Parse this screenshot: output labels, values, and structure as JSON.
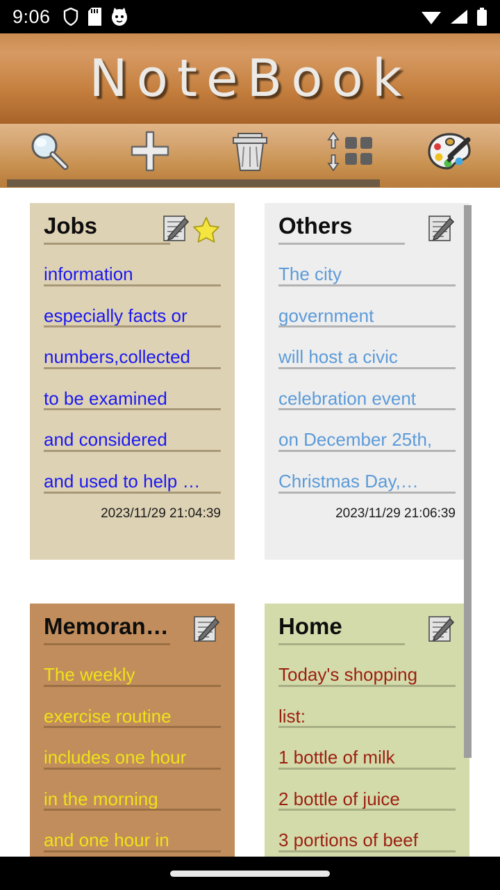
{
  "status_bar": {
    "time": "9:06",
    "left_icons": [
      "shield-icon",
      "sd-card-icon",
      "cat-face-icon"
    ],
    "right_icons": [
      "wifi-icon",
      "signal-icon",
      "battery-icon"
    ]
  },
  "header": {
    "app_title": "NoteBook",
    "gradient_from": "#d79a63",
    "gradient_to": "#a8632a"
  },
  "toolbar": {
    "items": [
      {
        "name": "search-icon",
        "label": "Search"
      },
      {
        "name": "add-icon",
        "label": "Add"
      },
      {
        "name": "delete-icon",
        "label": "Delete"
      },
      {
        "name": "sort-icon",
        "label": "Sort"
      },
      {
        "name": "palette-icon",
        "label": "Theme"
      }
    ]
  },
  "notes": [
    {
      "title": "Jobs",
      "starred": true,
      "bg": "#ded2b4",
      "text_color": "#1b18f0",
      "lines": [
        "information",
        "especially facts or",
        "numbers,collected",
        "to be examined",
        "and considered",
        "and used to help …"
      ],
      "timestamp": "2023/11/29  21:04:39"
    },
    {
      "title": "Others",
      "starred": false,
      "bg": "#efeeee",
      "text_color": "#5b9bd9",
      "lines": [
        "The city",
        "government",
        "will host a civic",
        "celebration event",
        "on December 25th,",
        "Christmas Day,…"
      ],
      "timestamp": "2023/11/29  21:06:39"
    },
    {
      "title": "Memoran…",
      "starred": false,
      "bg": "#c18d5c",
      "text_color": "#efe219",
      "lines": [
        "The weekly",
        "exercise routine",
        "includes one hour",
        "in the morning",
        "and one hour in"
      ],
      "timestamp": ""
    },
    {
      "title": "Home",
      "starred": false,
      "bg": "#d3dbab",
      "text_color": "#9c1f10",
      "lines": [
        "Today's shopping",
        "list:",
        "1 bottle of milk",
        "2 bottle of juice",
        "3 portions of beef"
      ],
      "timestamp": ""
    }
  ],
  "scrollbar": {
    "name": "vertical-scrollbar",
    "color": "#9e9e9e"
  },
  "nav_bar": {
    "gesture_pill": "home-gesture-pill"
  }
}
